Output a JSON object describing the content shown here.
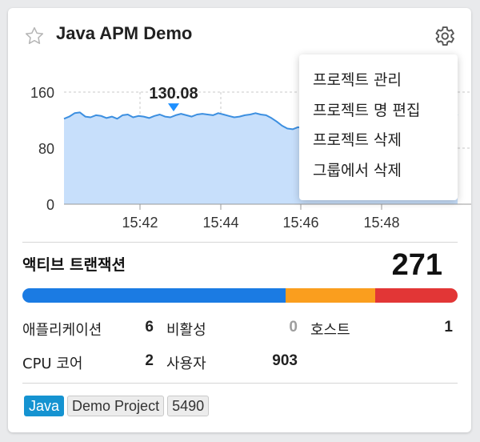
{
  "header": {
    "title": "Java APM Demo",
    "star_icon": "star-outline-icon",
    "settings_icon": "gear-icon"
  },
  "menu": {
    "items": [
      {
        "label": "프로젝트 관리"
      },
      {
        "label": "프로젝트 명 편집"
      },
      {
        "label": "프로젝트 삭제"
      },
      {
        "label": "그룹에서 삭제"
      }
    ]
  },
  "chart_data": {
    "type": "area",
    "yticks": [
      "160",
      "80",
      "0"
    ],
    "xticks": [
      "15:42",
      "15:44",
      "15:46",
      "15:48"
    ],
    "ylim": [
      0,
      160
    ],
    "peak_label": "130.08",
    "peak_marker_color": "#1e90ff",
    "line_color": "#3c8fe0",
    "fill_color": "#c7dffb",
    "series": [
      {
        "values": [
          122,
          125,
          130,
          131,
          125,
          124,
          127,
          126,
          123,
          125,
          122,
          127,
          128,
          124,
          126,
          125,
          123,
          126,
          128,
          125,
          124,
          127,
          129,
          127,
          125,
          128,
          129,
          128,
          127,
          130,
          128,
          126,
          124,
          125,
          127,
          128,
          130,
          128,
          127,
          123,
          118,
          112,
          108,
          107,
          110,
          108,
          105,
          108,
          110,
          112,
          108,
          106,
          104,
          103,
          105,
          104,
          100,
          98,
          97,
          98,
          100,
          105,
          108,
          107,
          110,
          112,
          115,
          118,
          120,
          122,
          124,
          125,
          127,
          126,
          128
        ]
      }
    ]
  },
  "active_transactions": {
    "label": "액티브 트랜잭션",
    "value": "271",
    "segments": [
      {
        "color": "#1b7be3",
        "fraction": 0.604
      },
      {
        "color": "#fa9e1e",
        "fraction": 0.206
      },
      {
        "color": "#e23636",
        "fraction": 0.19
      }
    ]
  },
  "stats": {
    "applications": {
      "label": "애플리케이션",
      "value": "6"
    },
    "inactive": {
      "label": "비활성",
      "value": "0"
    },
    "hosts": {
      "label": "호스트",
      "value": "1"
    },
    "cpu_cores": {
      "label": "CPU 코어",
      "value": "2"
    },
    "users": {
      "label": "사용자",
      "value": "903"
    }
  },
  "tags": [
    {
      "label": "Java"
    },
    {
      "label": "Demo Project"
    },
    {
      "label": "5490"
    }
  ]
}
